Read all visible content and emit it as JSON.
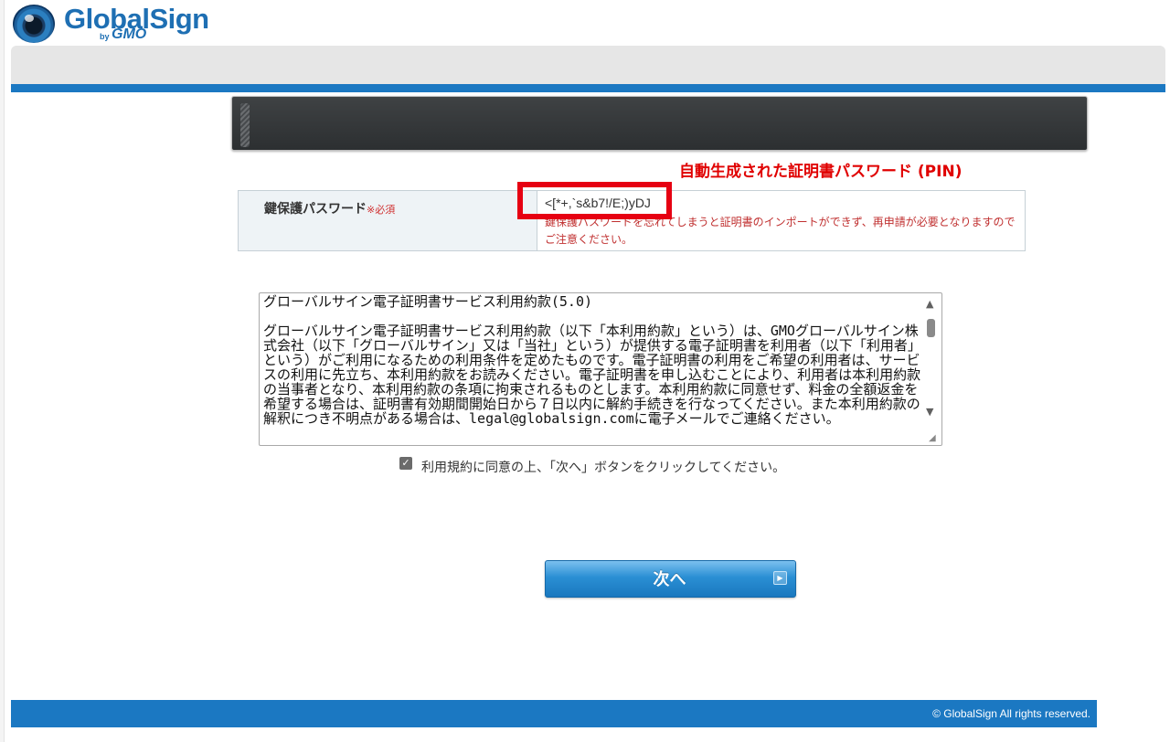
{
  "logo": {
    "brand": "GlobalSign",
    "dot": ".",
    "by": "by",
    "gmo": "GMO"
  },
  "annotation": "自動生成された証明書パスワード (PIN)",
  "form": {
    "label": "鍵保護パスワード",
    "required": "※必須",
    "password": "<[*+,`s&b7!/E;)yDJ",
    "warning": "鍵保護パスワードを忘れてしまうと証明書のインポートができず、再申請が必要となりますのでご注意ください。"
  },
  "terms": {
    "text": "グローバルサイン電子証明書サービス利用約款(5.0)\n\nグローバルサイン電子証明書サービス利用約款（以下「本利用約款」という）は、GMOグローバルサイン株式会社（以下「グローバルサイン」又は「当社」という）が提供する電子証明書を利用者（以下「利用者」という）がご利用になるための利用条件を定めたものです。電子証明書の利用をご希望の利用者は、サービスの利用に先立ち、本利用約款をお読みください。電子証明書を申し込むことにより、利用者は本利用約款の当事者となり、本利用約款の条項に拘束されるものとします。本利用約款に同意せず、料金の全額返金を希望する場合は、証明書有効期間開始日から７日以内に解約手続きを行なってください。また本利用約款の解釈につき不明点がある場合は、legal@globalsign.comに電子メールでご連絡ください。"
  },
  "consent": {
    "checked": true,
    "check_glyph": "✓",
    "label": "利用規約に同意の上、「次へ」ボタンをクリックしてください。"
  },
  "next_button": {
    "label": "次へ",
    "arrow": "▶"
  },
  "footer": {
    "copyright": "© GlobalSign All rights reserved."
  },
  "scrollbar": {
    "up": "▲",
    "down": "▼",
    "grip": "◢"
  },
  "colors": {
    "accent_blue": "#1b78c2",
    "annotation_red": "#e00000",
    "required_red": "#d03030"
  }
}
